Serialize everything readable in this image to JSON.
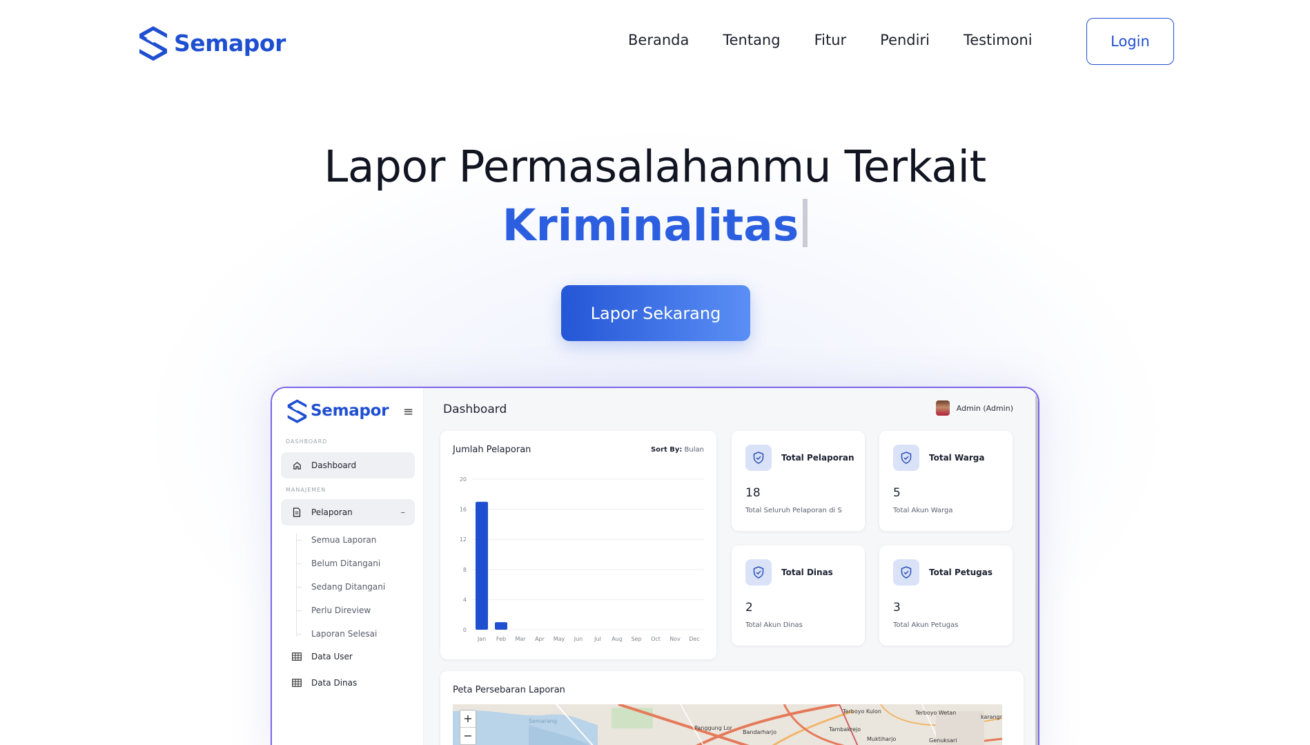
{
  "brand": {
    "name": "Semapor",
    "accent": "#1f4fd1"
  },
  "nav": {
    "items": [
      "Beranda",
      "Tentang",
      "Fitur",
      "Pendiri",
      "Testimoni"
    ],
    "login_label": "Login"
  },
  "hero": {
    "title_line1": "Lapor Permasalahanmu Terkait",
    "title_line2": "Kriminalitas",
    "cta_label": "Lapor Sekarang"
  },
  "preview": {
    "brand": "Semapor",
    "sidebar": {
      "caption_dashboard": "DASHBOARD",
      "caption_manajemen": "MANAJEMEN",
      "dashboard_label": "Dashboard",
      "pelaporan_label": "Pelaporan",
      "pelaporan_toggle": "–",
      "sub_items": [
        "Semua Laporan",
        "Belum Ditangani",
        "Sedang Ditangani",
        "Perlu Direview",
        "Laporan Selesai"
      ],
      "data_user_label": "Data User",
      "data_dinas_label": "Data Dinas"
    },
    "header": {
      "title": "Dashboard",
      "user": "Admin (Admin)"
    },
    "chart_card": {
      "title": "Jumlah Pelaporan",
      "sort_label": "Sort By:",
      "sort_value": "Bulan"
    },
    "stats": [
      {
        "title": "Total Pelaporan",
        "value": "18",
        "desc": "Total Seluruh Pelaporan di S"
      },
      {
        "title": "Total Warga",
        "value": "5",
        "desc": "Total Akun Warga"
      },
      {
        "title": "Total Dinas",
        "value": "2",
        "desc": "Total Akun Dinas"
      },
      {
        "title": "Total Petugas",
        "value": "3",
        "desc": "Total Akun Petugas"
      }
    ],
    "map_card": {
      "title": "Peta Persebaran Laporan",
      "zoom_in": "+",
      "zoom_out": "−",
      "labels": [
        "Semarang",
        "Panggung Lor",
        "Bandarharjo",
        "Tambakrejo",
        "Terboyo Kulon",
        "Terboyo Wetan",
        "Muktiharjo",
        "Genuksari",
        "karangr"
      ]
    }
  },
  "chart_data": {
    "type": "bar",
    "title": "Jumlah Pelaporan",
    "categories": [
      "Jan",
      "Feb",
      "Mar",
      "Apr",
      "May",
      "Jun",
      "Jul",
      "Aug",
      "Sep",
      "Oct",
      "Nov",
      "Dec"
    ],
    "values": [
      17,
      1,
      0,
      0,
      0,
      0,
      0,
      0,
      0,
      0,
      0,
      0
    ],
    "yticks": [
      0,
      4,
      8,
      12,
      16,
      20
    ],
    "ylim": [
      0,
      20
    ],
    "bar_color": "#1f4fd1",
    "grid": true
  }
}
